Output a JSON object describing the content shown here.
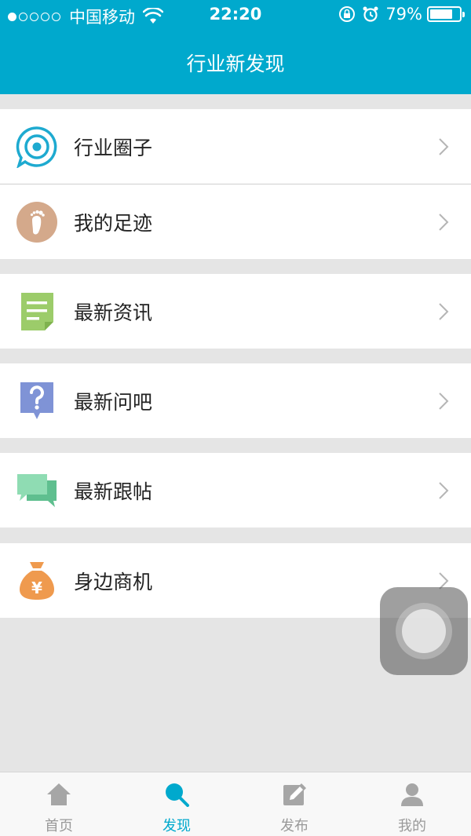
{
  "status_bar": {
    "carrier": "中国移动",
    "time": "22:20",
    "battery_percent": "79%",
    "battery_level": 0.79,
    "signal_bars_filled": 1,
    "signal_bars_total": 5
  },
  "header": {
    "title": "行业新发现"
  },
  "menu": [
    {
      "label": "行业圈子",
      "icon": "target-chat-icon",
      "color": "#1eaad0"
    },
    {
      "label": "我的足迹",
      "icon": "footprint-icon",
      "color": "#d4a98b"
    },
    {
      "label": "最新资讯",
      "icon": "document-icon",
      "color": "#9ccc6a"
    },
    {
      "label": "最新问吧",
      "icon": "question-icon",
      "color": "#7f93d6"
    },
    {
      "label": "最新跟帖",
      "icon": "chat-bubbles-icon",
      "color": "#7dd3a6"
    },
    {
      "label": "身边商机",
      "icon": "money-bag-icon",
      "color": "#ef9a4e"
    }
  ],
  "tabs": [
    {
      "label": "首页",
      "icon": "home-icon",
      "active": false
    },
    {
      "label": "发现",
      "icon": "search-icon",
      "active": true
    },
    {
      "label": "发布",
      "icon": "edit-icon",
      "active": false
    },
    {
      "label": "我的",
      "icon": "user-icon",
      "active": false
    }
  ],
  "colors": {
    "accent": "#00a9cd",
    "inactive": "#999999",
    "background": "#e5e5e5"
  }
}
